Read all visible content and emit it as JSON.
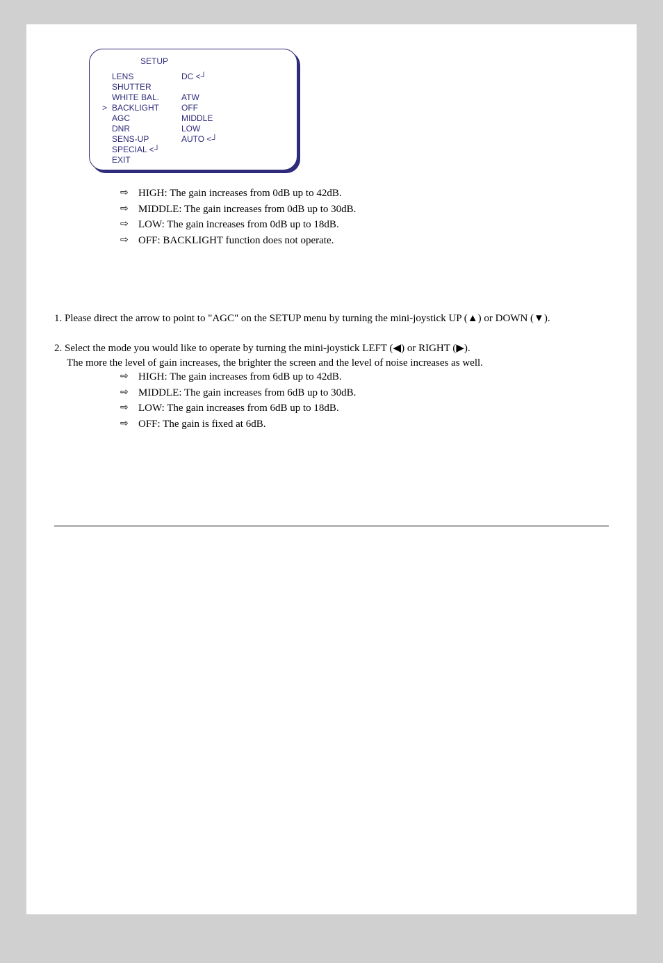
{
  "osd": {
    "title": "SETUP",
    "rows": [
      {
        "marker": "",
        "name": "LENS",
        "value": "DC <┘"
      },
      {
        "marker": "",
        "name": "SHUTTER",
        "value": ""
      },
      {
        "marker": "",
        "name": "WHITE BAL.",
        "value": "ATW"
      },
      {
        "marker": ">",
        "name": "BACKLIGHT",
        "value": "OFF"
      },
      {
        "marker": "",
        "name": "AGC",
        "value": "MIDDLE"
      },
      {
        "marker": "",
        "name": "DNR",
        "value": "LOW"
      },
      {
        "marker": "",
        "name": "SENS-UP",
        "value": "AUTO <┘"
      },
      {
        "marker": "",
        "name": "SPECIAL <┘",
        "value": ""
      },
      {
        "marker": "",
        "name": "EXIT",
        "value": ""
      }
    ]
  },
  "backlight_bullets": [
    "HIGH: The gain increases from 0dB up to 42dB.",
    "MIDDLE: The gain increases from 0dB up to 30dB.",
    "LOW: The gain increases from 0dB up to 18dB.",
    "OFF: BACKLIGHT function does not operate."
  ],
  "steps": {
    "s1": "1. Please direct the arrow to point to \"AGC\" on the SETUP menu by turning the mini-joystick UP (▲) or DOWN (▼).",
    "s2a": "2. Select the mode you would like to operate by turning the mini-joystick LEFT (◀) or RIGHT (▶).",
    "s2b": "The more the level of gain increases, the brighter the screen and the level of noise increases as well."
  },
  "agc_bullets": [
    "HIGH: The gain increases from 6dB up to 42dB.",
    "MIDDLE: The gain increases from 6dB up to 30dB.",
    "LOW: The gain increases from 6dB up to 18dB.",
    "OFF: The gain is fixed at 6dB."
  ],
  "arrow_glyph": "⇨"
}
